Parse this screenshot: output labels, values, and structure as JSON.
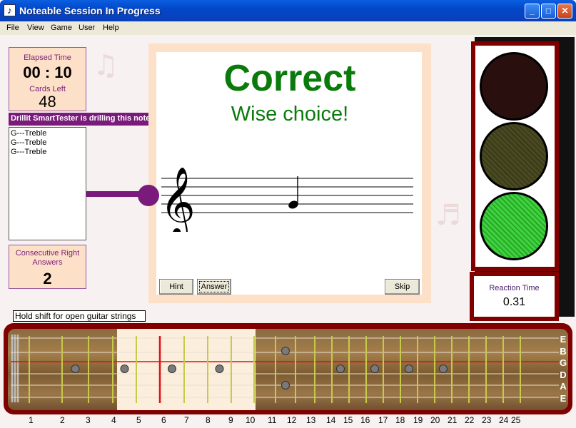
{
  "window": {
    "title": "Noteable Session In Progress"
  },
  "menu": [
    "File",
    "View",
    "Game",
    "User",
    "Help"
  ],
  "stats": {
    "elapsed_label": "Elapsed Time",
    "elapsed_value": "00:10",
    "cards_label": "Cards Left",
    "cards_value": "48",
    "consecutive_label": "Consecutive Right Answers",
    "consecutive_value": "2"
  },
  "drill": {
    "banner": "Drillit SmartTester is drilling this note.",
    "items": [
      "G---Treble",
      "G---Treble",
      "G---Treble"
    ]
  },
  "card": {
    "result": "Correct",
    "message": "Wise choice!",
    "clef": "treble",
    "note": "G"
  },
  "buttons": {
    "hint": "Hint",
    "answer": "Answer",
    "skip": "Skip"
  },
  "traffic_light": {
    "active": "green"
  },
  "reaction": {
    "label": "Reaction Time",
    "value": "0.31"
  },
  "hint_text": "Hold shift for open guitar strings",
  "fretboard": {
    "strings": [
      "E",
      "B",
      "G",
      "D",
      "A",
      "E"
    ],
    "fret_numbers": [
      "1",
      "2",
      "3",
      "4",
      "5",
      "6",
      "7",
      "8",
      "9",
      "10",
      "11",
      "12",
      "13",
      "14",
      "15",
      "16",
      "17",
      "18",
      "19",
      "20",
      "21",
      "22",
      "23",
      "24",
      "25"
    ],
    "highlight_frets": [
      5,
      9
    ],
    "marker_frets": [
      3,
      5,
      7,
      9,
      12,
      15,
      17,
      19,
      21
    ],
    "active_fret": 6,
    "active_string": 3,
    "colors": {
      "fret": "#c8c84a",
      "active": "#e01010",
      "highlight": "#fbeedd"
    }
  }
}
